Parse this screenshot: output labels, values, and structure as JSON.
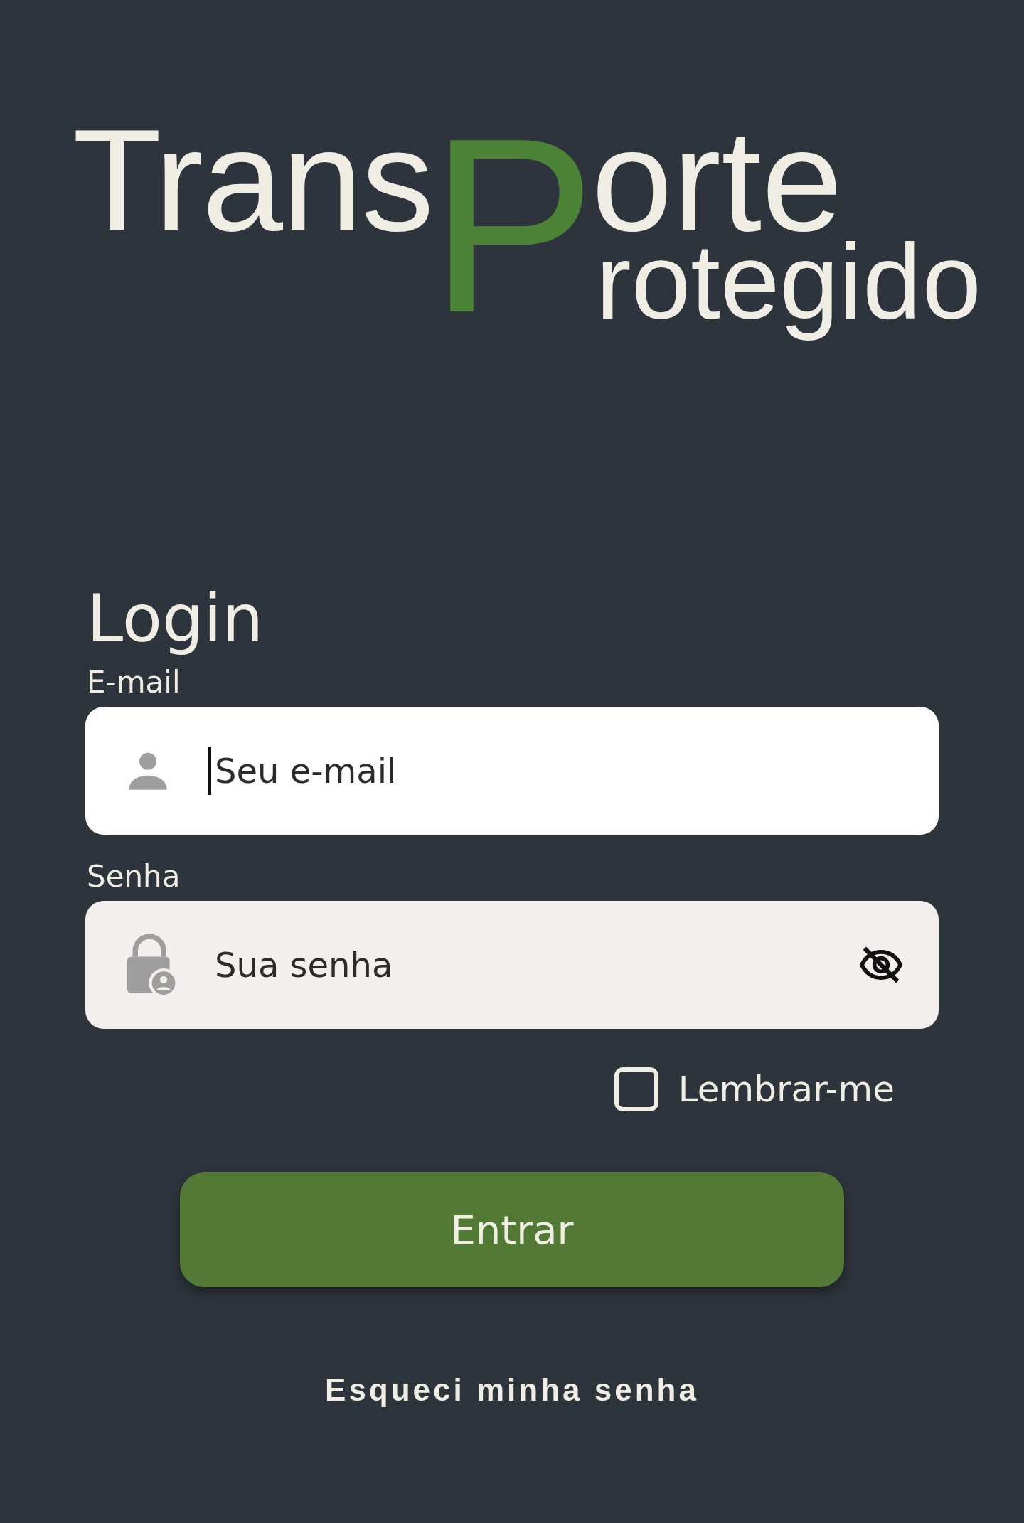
{
  "logo": {
    "first": "Trans",
    "shared_letter": "P",
    "rest": "orte",
    "second_line": "rotegido"
  },
  "title": "Login",
  "fields": [
    {
      "kind": "email",
      "label": "E-mail",
      "placeholder": "Seu e-mail",
      "focused": true
    },
    {
      "kind": "password",
      "label": "Senha",
      "placeholder": "Sua senha",
      "focused": false
    }
  ],
  "remember": {
    "label": "Lembrar-me",
    "checked": false
  },
  "submit": "Entrar",
  "forgot_link": "Esqueci minha senha"
}
